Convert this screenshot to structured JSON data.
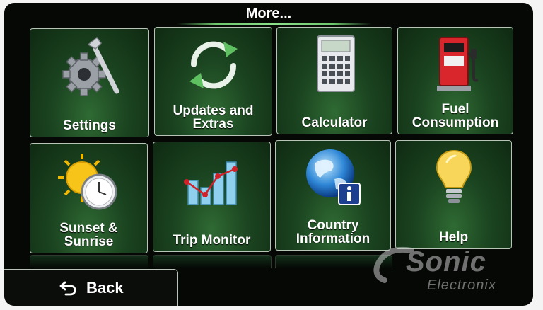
{
  "header": {
    "title": "More..."
  },
  "tiles": [
    {
      "label": "Settings",
      "icon": "settings-gear-wrench-icon"
    },
    {
      "label": "Updates and\nExtras",
      "icon": "refresh-arrows-icon"
    },
    {
      "label": "Calculator",
      "icon": "calculator-icon"
    },
    {
      "label": "Fuel\nConsumption",
      "icon": "fuel-pump-icon"
    },
    {
      "label": "Sunset &\nSunrise",
      "icon": "sun-clock-icon"
    },
    {
      "label": "Trip Monitor",
      "icon": "trip-chart-icon"
    },
    {
      "label": "Country\nInformation",
      "icon": "globe-info-icon"
    },
    {
      "label": "Help",
      "icon": "light-bulb-icon"
    }
  ],
  "footer": {
    "back_label": "Back"
  },
  "watermark": {
    "brand": "Sonic",
    "sub": "Electronix"
  },
  "colors": {
    "tile_green": "#1b4420",
    "tile_border": "#b8c4b8",
    "title_underline": "#8ce08c",
    "background": "#050805"
  }
}
